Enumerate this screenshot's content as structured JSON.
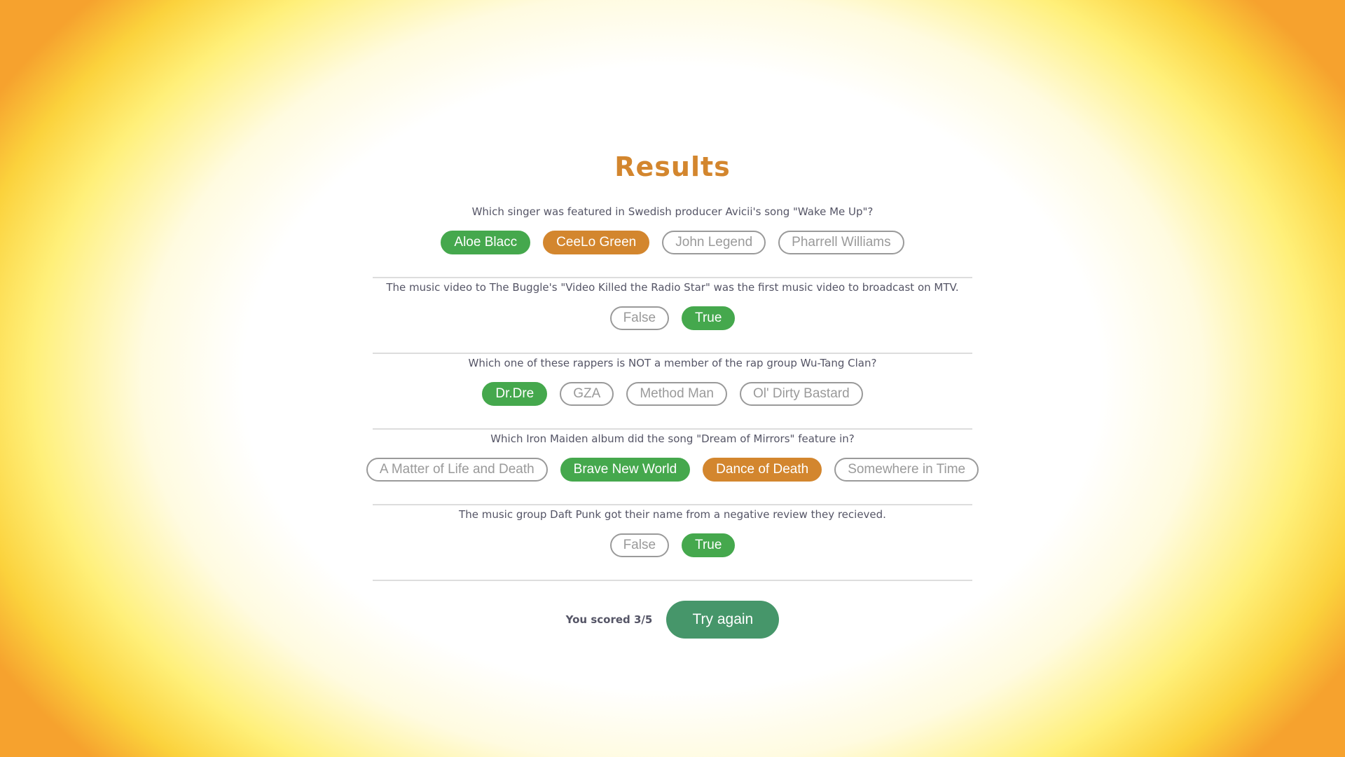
{
  "title": "Results",
  "colors": {
    "accent": "#d3862e",
    "correct": "#45a84d",
    "wrong": "#d3862e",
    "button": "#46966a"
  },
  "questions": [
    {
      "text": "Which singer was featured in Swedish producer Avicii's song \"Wake Me Up\"?",
      "options": [
        {
          "label": "Aloe Blacc",
          "state": "correct"
        },
        {
          "label": "CeeLo Green",
          "state": "wrong"
        },
        {
          "label": "John Legend",
          "state": "neutral"
        },
        {
          "label": "Pharrell Williams",
          "state": "neutral"
        }
      ]
    },
    {
      "text": "The music video to The Buggle's \"Video Killed the Radio Star\" was the first music video to broadcast on MTV.",
      "options": [
        {
          "label": "False",
          "state": "neutral"
        },
        {
          "label": "True",
          "state": "correct"
        }
      ]
    },
    {
      "text": "Which one of these rappers is NOT a member of the rap group Wu-Tang Clan?",
      "options": [
        {
          "label": "Dr.Dre",
          "state": "correct"
        },
        {
          "label": "GZA",
          "state": "neutral"
        },
        {
          "label": "Method Man",
          "state": "neutral"
        },
        {
          "label": "Ol' Dirty Bastard",
          "state": "neutral"
        }
      ]
    },
    {
      "text": "Which Iron Maiden album did the song \"Dream of Mirrors\" feature in?",
      "options": [
        {
          "label": "A Matter of Life and Death",
          "state": "neutral"
        },
        {
          "label": "Brave New World",
          "state": "correct"
        },
        {
          "label": "Dance of Death",
          "state": "wrong"
        },
        {
          "label": "Somewhere in Time",
          "state": "neutral"
        }
      ]
    },
    {
      "text": "The music group Daft Punk got their name from a negative review they recieved.",
      "options": [
        {
          "label": "False",
          "state": "neutral"
        },
        {
          "label": "True",
          "state": "correct"
        }
      ]
    }
  ],
  "footer": {
    "score_text": "You scored 3/5",
    "button_label": "Try again"
  }
}
